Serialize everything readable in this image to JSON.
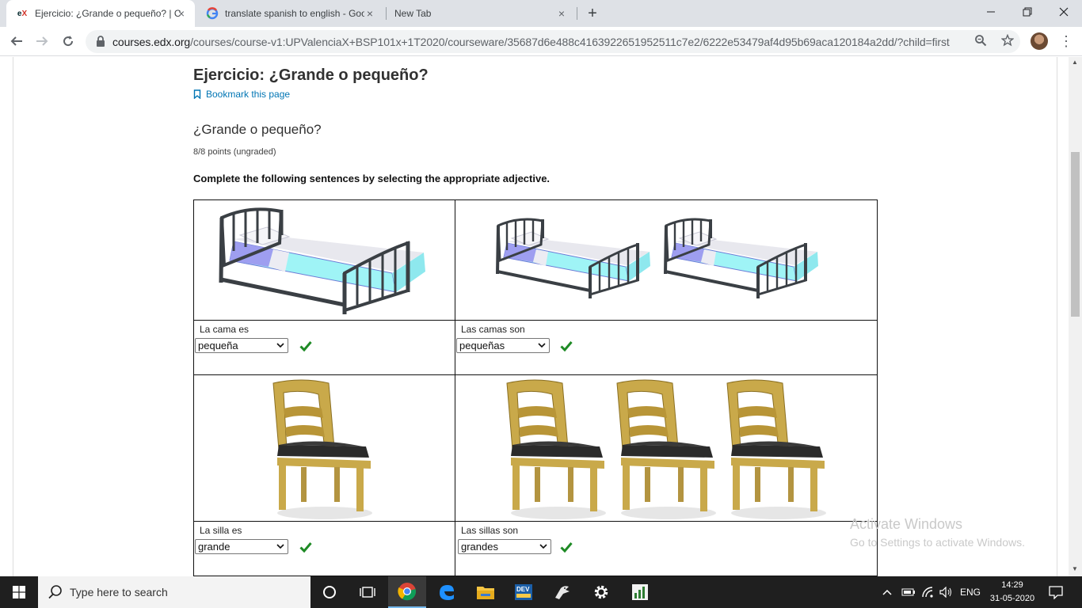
{
  "browser": {
    "tabs": [
      {
        "label": "Ejercicio: ¿Grande o pequeño? | C",
        "favicon": "edx"
      },
      {
        "label": "translate spanish to english - Goo",
        "favicon": "google"
      },
      {
        "label": "New Tab",
        "favicon": ""
      }
    ],
    "url_domain": "courses.edx.org",
    "url_path": "/courses/course-v1:UPValenciaX+BSP101x+1T2020/courseware/35687d6e488c4163922651952511c7e2/6222e53479af4d95b69aca120184a2dd/?child=first"
  },
  "page": {
    "title": "Ejercicio: ¿Grande o pequeño?",
    "bookmark_label": "Bookmark this page",
    "problem_title": "¿Grande o pequeño?",
    "points": "8/8 points (ungraded)",
    "instruction": "Complete the following sentences by selecting the appropriate adjective."
  },
  "exercise": {
    "items": [
      {
        "label": "La cama es",
        "selected": "pequeña",
        "image": "one-bed"
      },
      {
        "label": "Las camas son",
        "selected": "pequeñas",
        "image": "two-beds"
      },
      {
        "label": "La silla es",
        "selected": "grande",
        "image": "one-chair"
      },
      {
        "label": "Las sillas son",
        "selected": "grandes",
        "image": "three-chairs"
      }
    ]
  },
  "watermark": {
    "line1": "Activate Windows",
    "line2": "Go to Settings to activate Windows."
  },
  "taskbar": {
    "search_placeholder": "Type here to search",
    "language": "ENG",
    "time": "14:29",
    "date": "31-05-2020"
  },
  "colors": {
    "edx_link": "#0075b4",
    "check_green": "#1e8a25",
    "taskbar": "#1f1f1f"
  }
}
